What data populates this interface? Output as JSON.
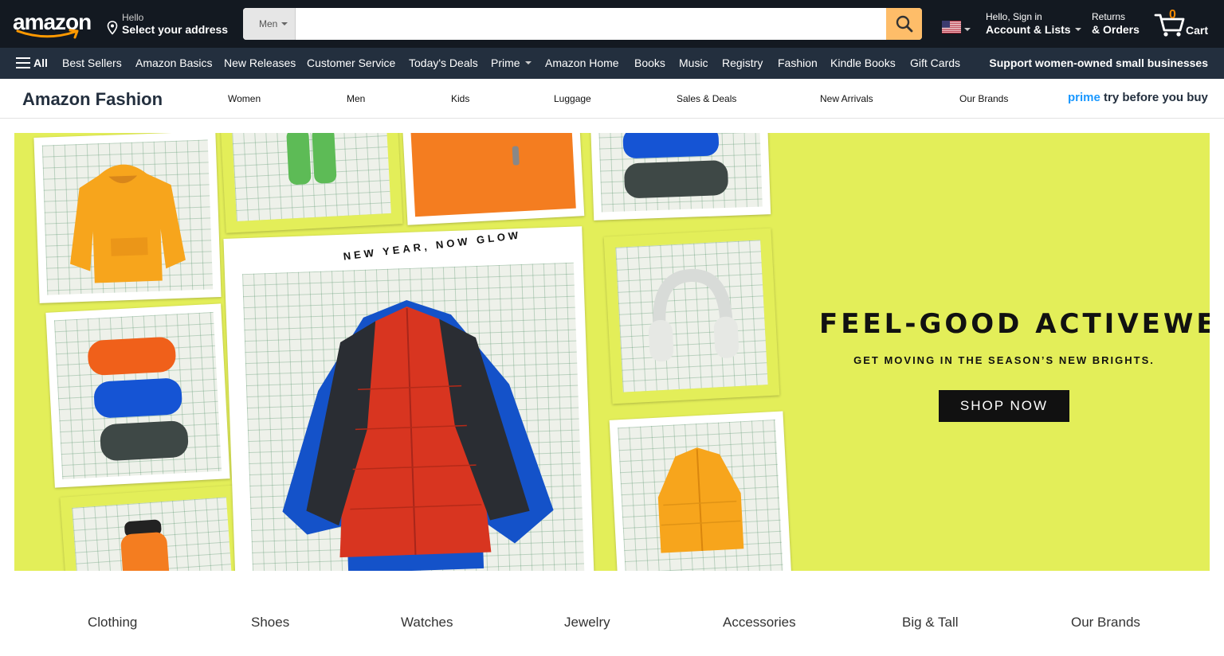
{
  "header": {
    "logo_text": "amazon",
    "deliver": {
      "line1": "Hello",
      "line2": "Select your address"
    },
    "search": {
      "department": "Men",
      "placeholder": "",
      "value": ""
    },
    "account": {
      "line1": "Hello, Sign in",
      "line2": "Account & Lists"
    },
    "returns": {
      "line1": "Returns",
      "line2": "& Orders"
    },
    "cart": {
      "count": "0",
      "label": "Cart"
    },
    "colors": {
      "bg": "#131921",
      "search_button": "#febd69",
      "cart_count": "#f08804"
    }
  },
  "subnav": {
    "all_label": "All",
    "items": [
      "Best Sellers",
      "Amazon Basics",
      "New Releases",
      "Customer Service",
      "Today's Deals",
      "Prime",
      "Amazon Home",
      "Books",
      "Music",
      "Registry",
      "Fashion",
      "Kindle Books",
      "Gift Cards"
    ],
    "promo": "Support women-owned small businesses",
    "colors": {
      "bg": "#232f3e"
    }
  },
  "fashion_bar": {
    "brand": "Amazon Fashion",
    "items": [
      "Women",
      "Men",
      "Kids",
      "Luggage",
      "Sales & Deals",
      "New Arrivals",
      "Our Brands"
    ],
    "prime_word": "prime",
    "prime_tagline": "try before you buy"
  },
  "hero": {
    "tagline": "NEW YEAR, NOW GLOW",
    "headline": "FEEL-GOOD ACTIVEWEAR",
    "subhead": "GET MOVING IN THE SEASON’S NEW BRIGHTS.",
    "cta": "SHOP NOW",
    "colors": {
      "background": "#e3ee59",
      "cta_bg": "#111111"
    }
  },
  "categories": [
    "Clothing",
    "Shoes",
    "Watches",
    "Jewelry",
    "Accessories",
    "Big & Tall",
    "Our Brands"
  ]
}
